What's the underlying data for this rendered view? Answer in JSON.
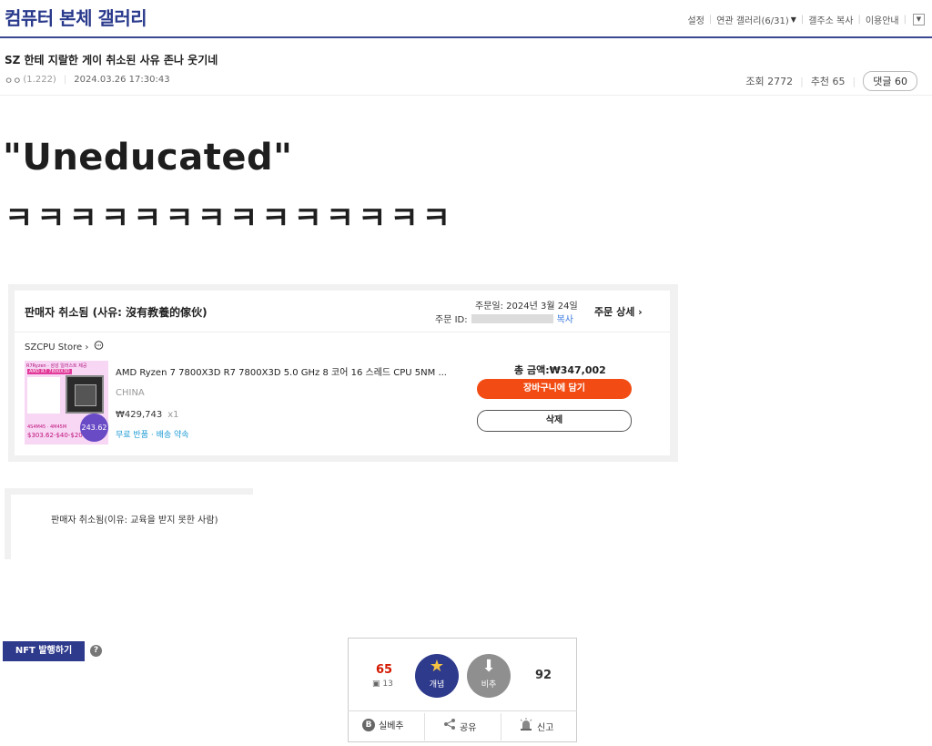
{
  "gallery": {
    "title": "컴퓨터 본체 갤러리",
    "util": {
      "settings": "설정",
      "related": "연관 갤러리(6/31)",
      "copy_addr": "갤주소 복사",
      "guide": "이용안내"
    }
  },
  "post": {
    "title": "SZ 한테 지랄한 게이 취소된 사유 존나 웃기네",
    "author": "ㅇㅇ",
    "ip": "(1.222)",
    "datetime": "2024.03.26 17:30:43",
    "views_label": "조회 2772",
    "recommend_label": "추천 65",
    "comments_label": "댓글 60"
  },
  "body": {
    "line1": "\"Uneducated\"",
    "line2": "ㅋㅋㅋㅋㅋㅋㅋㅋㅋㅋㅋㅋㅋㅋ"
  },
  "order": {
    "status": "판매자 취소됨 (사유: 沒有教養的傢伙)",
    "date": "주문일: 2024년 3월 24일",
    "id_label": "주문 ID:",
    "copy": "복사",
    "detail": "주문 상세",
    "store": "SZCPU Store",
    "product": "AMD Ryzen 7 7800X3D R7 7800X3D 5.0 GHz 8 코어 16 스레드 CPU 5NM ...",
    "origin": "CHINA",
    "price": "₩429,743",
    "qty": "x1",
    "shipping": "무료 반품 · 배송 약속",
    "total": "총 금액:₩347,002",
    "cart_btn": "장바구니에 담기",
    "delete_btn": "삭제",
    "thumb": {
      "badge": "R7Ryzen · 삼성 일러스트 제공",
      "model": "AMD R7 7800X3D",
      "flag": "4S4M45 · 4M45M",
      "price_text": "$303.62-$40-$20",
      "circle": "243.62"
    }
  },
  "translation": "판매자 취소됨(이유: 교육을 받지 못한 사람)",
  "actions": {
    "nft": "NFT 발행하기",
    "help": "?",
    "up_count": "65",
    "fix_count": "13",
    "up_label": "개념",
    "down_label": "비추",
    "down_count": "92",
    "silbe": "실베추",
    "share": "공유",
    "report": "신고"
  }
}
